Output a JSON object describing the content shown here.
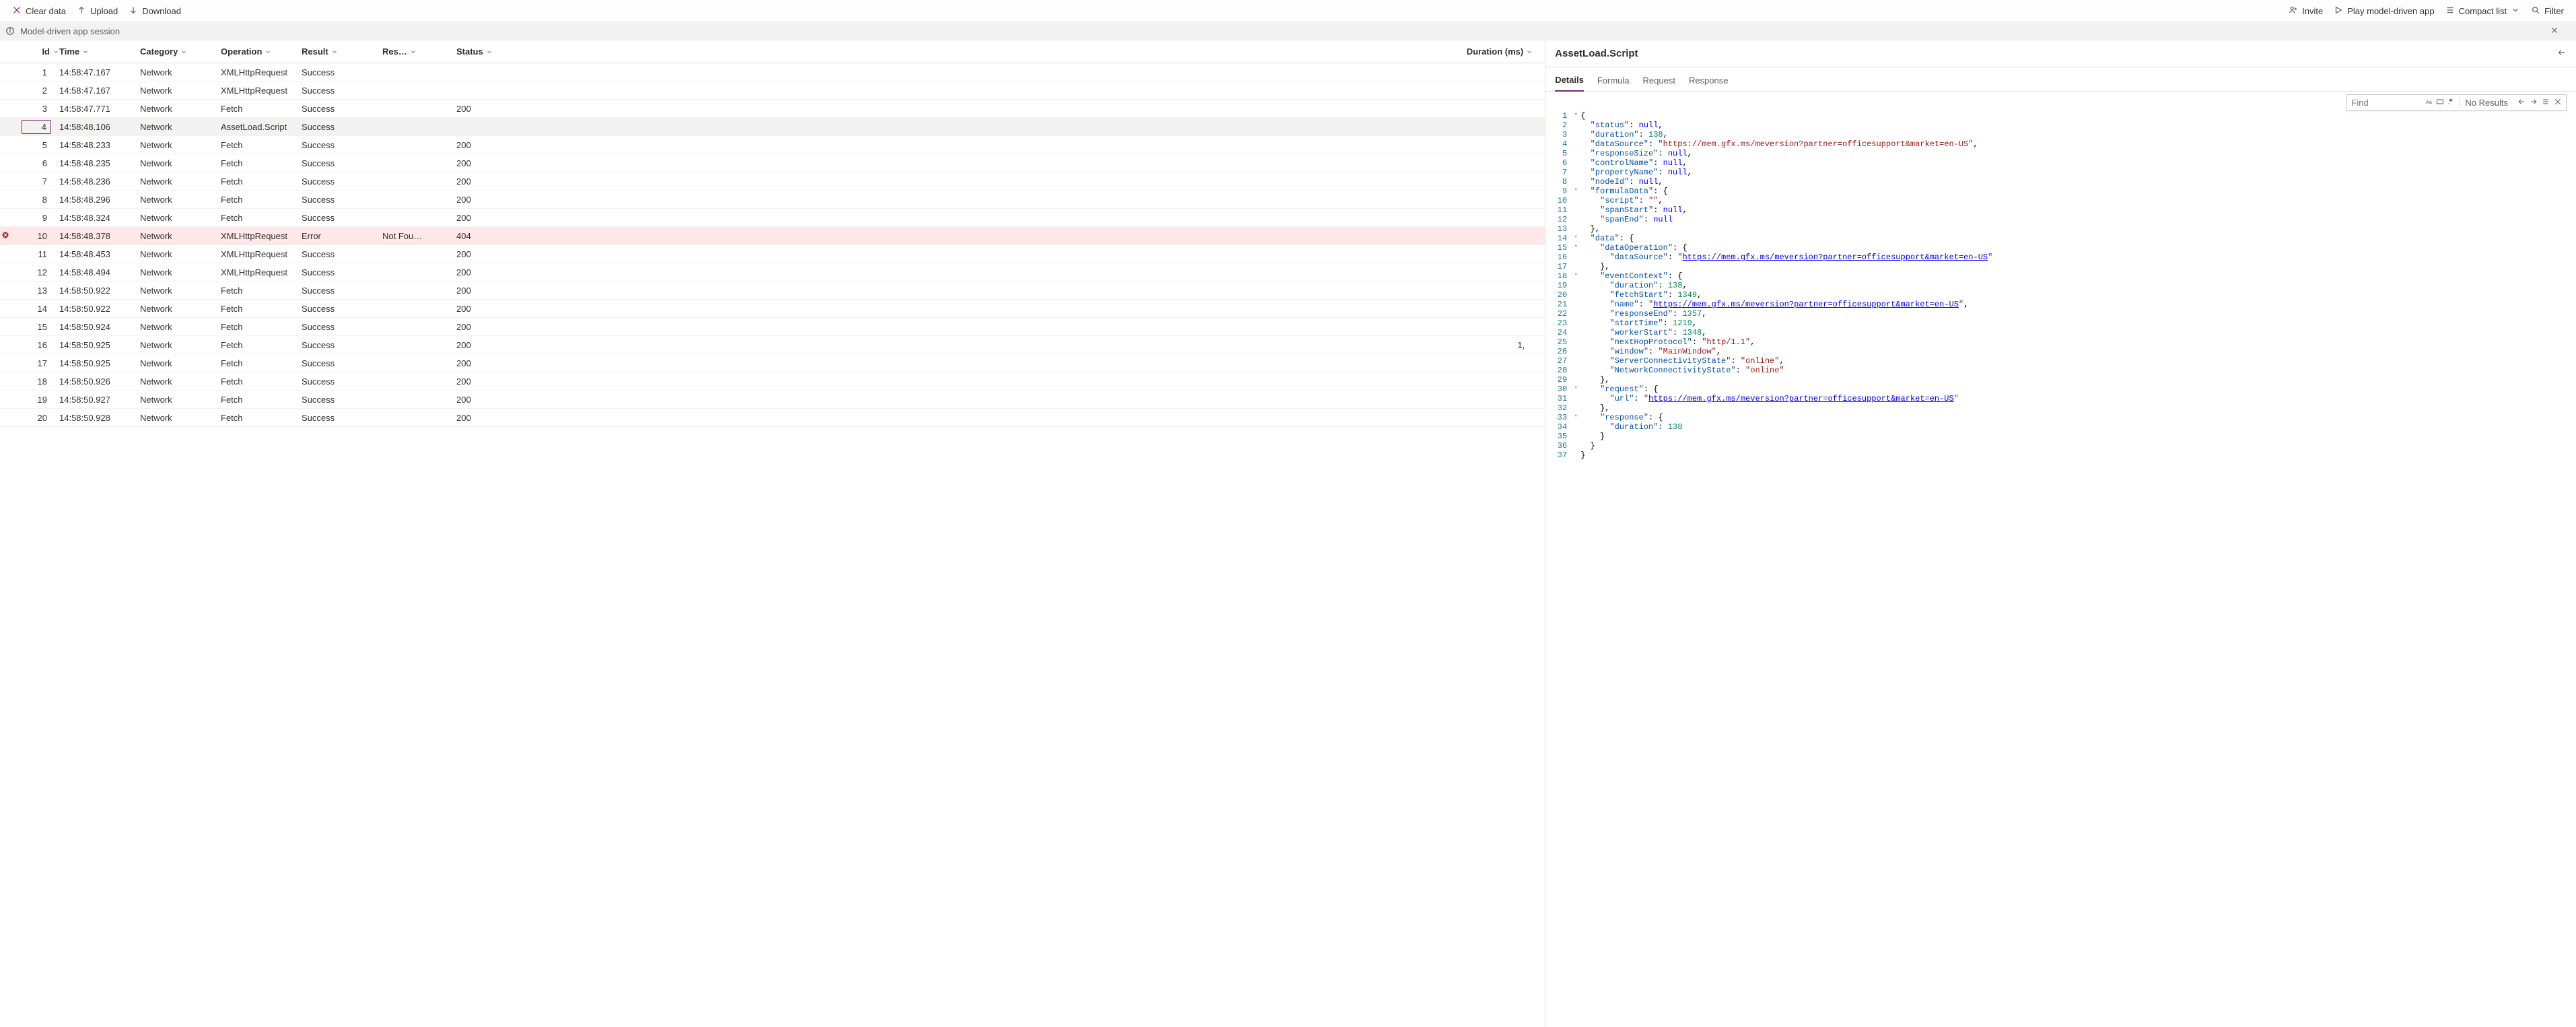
{
  "toolbar": {
    "clear": "Clear data",
    "upload": "Upload",
    "download": "Download",
    "invite": "Invite",
    "play": "Play model-driven app",
    "compact": "Compact list",
    "filter": "Filter"
  },
  "session_label": "Model-driven app session",
  "columns": {
    "id": "Id",
    "time": "Time",
    "category": "Category",
    "operation": "Operation",
    "result": "Result",
    "response": "Res…",
    "status": "Status",
    "duration": "Duration (ms)"
  },
  "rows": [
    {
      "id": "1",
      "time": "14:58:47.167",
      "cat": "Network",
      "op": "XMLHttpRequest",
      "res": "Success",
      "resp": "",
      "status": "",
      "dur": "",
      "err": false,
      "sel": false
    },
    {
      "id": "2",
      "time": "14:58:47.167",
      "cat": "Network",
      "op": "XMLHttpRequest",
      "res": "Success",
      "resp": "",
      "status": "",
      "dur": "",
      "err": false,
      "sel": false
    },
    {
      "id": "3",
      "time": "14:58:47.771",
      "cat": "Network",
      "op": "Fetch",
      "res": "Success",
      "resp": "",
      "status": "200",
      "dur": "",
      "err": false,
      "sel": false
    },
    {
      "id": "4",
      "time": "14:58:48.106",
      "cat": "Network",
      "op": "AssetLoad.Script",
      "res": "Success",
      "resp": "",
      "status": "",
      "dur": "",
      "err": false,
      "sel": true
    },
    {
      "id": "5",
      "time": "14:58:48.233",
      "cat": "Network",
      "op": "Fetch",
      "res": "Success",
      "resp": "",
      "status": "200",
      "dur": "",
      "err": false,
      "sel": false
    },
    {
      "id": "6",
      "time": "14:58:48.235",
      "cat": "Network",
      "op": "Fetch",
      "res": "Success",
      "resp": "",
      "status": "200",
      "dur": "",
      "err": false,
      "sel": false
    },
    {
      "id": "7",
      "time": "14:58:48.236",
      "cat": "Network",
      "op": "Fetch",
      "res": "Success",
      "resp": "",
      "status": "200",
      "dur": "",
      "err": false,
      "sel": false
    },
    {
      "id": "8",
      "time": "14:58:48.296",
      "cat": "Network",
      "op": "Fetch",
      "res": "Success",
      "resp": "",
      "status": "200",
      "dur": "",
      "err": false,
      "sel": false
    },
    {
      "id": "9",
      "time": "14:58:48.324",
      "cat": "Network",
      "op": "Fetch",
      "res": "Success",
      "resp": "",
      "status": "200",
      "dur": "",
      "err": false,
      "sel": false
    },
    {
      "id": "10",
      "time": "14:58:48.378",
      "cat": "Network",
      "op": "XMLHttpRequest",
      "res": "Error",
      "resp": "Not Fou…",
      "status": "404",
      "dur": "",
      "err": true,
      "sel": false
    },
    {
      "id": "11",
      "time": "14:58:48.453",
      "cat": "Network",
      "op": "XMLHttpRequest",
      "res": "Success",
      "resp": "",
      "status": "200",
      "dur": "",
      "err": false,
      "sel": false
    },
    {
      "id": "12",
      "time": "14:58:48.494",
      "cat": "Network",
      "op": "XMLHttpRequest",
      "res": "Success",
      "resp": "",
      "status": "200",
      "dur": "",
      "err": false,
      "sel": false
    },
    {
      "id": "13",
      "time": "14:58:50.922",
      "cat": "Network",
      "op": "Fetch",
      "res": "Success",
      "resp": "",
      "status": "200",
      "dur": "",
      "err": false,
      "sel": false
    },
    {
      "id": "14",
      "time": "14:58:50.922",
      "cat": "Network",
      "op": "Fetch",
      "res": "Success",
      "resp": "",
      "status": "200",
      "dur": "",
      "err": false,
      "sel": false
    },
    {
      "id": "15",
      "time": "14:58:50.924",
      "cat": "Network",
      "op": "Fetch",
      "res": "Success",
      "resp": "",
      "status": "200",
      "dur": "",
      "err": false,
      "sel": false
    },
    {
      "id": "16",
      "time": "14:58:50.925",
      "cat": "Network",
      "op": "Fetch",
      "res": "Success",
      "resp": "",
      "status": "200",
      "dur": "1,",
      "err": false,
      "sel": false
    },
    {
      "id": "17",
      "time": "14:58:50.925",
      "cat": "Network",
      "op": "Fetch",
      "res": "Success",
      "resp": "",
      "status": "200",
      "dur": "",
      "err": false,
      "sel": false
    },
    {
      "id": "18",
      "time": "14:58:50.926",
      "cat": "Network",
      "op": "Fetch",
      "res": "Success",
      "resp": "",
      "status": "200",
      "dur": "",
      "err": false,
      "sel": false
    },
    {
      "id": "19",
      "time": "14:58:50.927",
      "cat": "Network",
      "op": "Fetch",
      "res": "Success",
      "resp": "",
      "status": "200",
      "dur": "",
      "err": false,
      "sel": false
    },
    {
      "id": "20",
      "time": "14:58:50.928",
      "cat": "Network",
      "op": "Fetch",
      "res": "Success",
      "resp": "",
      "status": "200",
      "dur": "",
      "err": false,
      "sel": false
    }
  ],
  "detail": {
    "title": "AssetLoad.Script",
    "tabs": {
      "details": "Details",
      "formula": "Formula",
      "request": "Request",
      "response": "Response"
    },
    "find_placeholder": "Find",
    "find_results": "No Results"
  },
  "code": [
    {
      "n": 1,
      "f": "▾",
      "i": 0,
      "t": [
        [
          "p",
          "{"
        ]
      ]
    },
    {
      "n": 2,
      "f": "",
      "i": 1,
      "t": [
        [
          "k",
          "\"status\""
        ],
        [
          "p",
          ": "
        ],
        [
          "nl",
          "null"
        ],
        [
          "p",
          ","
        ]
      ]
    },
    {
      "n": 3,
      "f": "",
      "i": 1,
      "t": [
        [
          "k",
          "\"duration\""
        ],
        [
          "p",
          ": "
        ],
        [
          "n",
          "138"
        ],
        [
          "p",
          ","
        ]
      ]
    },
    {
      "n": 4,
      "f": "",
      "i": 1,
      "t": [
        [
          "k",
          "\"dataSource\""
        ],
        [
          "p",
          ": "
        ],
        [
          "s",
          "\"https://mem.gfx.ms/meversion?partner=officesupport&market=en-US\""
        ],
        [
          "p",
          ","
        ]
      ]
    },
    {
      "n": 5,
      "f": "",
      "i": 1,
      "t": [
        [
          "k",
          "\"responseSize\""
        ],
        [
          "p",
          ": "
        ],
        [
          "nl",
          "null"
        ],
        [
          "p",
          ","
        ]
      ]
    },
    {
      "n": 6,
      "f": "",
      "i": 1,
      "t": [
        [
          "k",
          "\"controlName\""
        ],
        [
          "p",
          ": "
        ],
        [
          "nl",
          "null"
        ],
        [
          "p",
          ","
        ]
      ]
    },
    {
      "n": 7,
      "f": "",
      "i": 1,
      "t": [
        [
          "k",
          "\"propertyName\""
        ],
        [
          "p",
          ": "
        ],
        [
          "nl",
          "null"
        ],
        [
          "p",
          ","
        ]
      ]
    },
    {
      "n": 8,
      "f": "",
      "i": 1,
      "t": [
        [
          "k",
          "\"nodeId\""
        ],
        [
          "p",
          ": "
        ],
        [
          "nl",
          "null"
        ],
        [
          "p",
          ","
        ]
      ]
    },
    {
      "n": 9,
      "f": "▾",
      "i": 1,
      "t": [
        [
          "k",
          "\"formulaData\""
        ],
        [
          "p",
          ": {"
        ]
      ]
    },
    {
      "n": 10,
      "f": "",
      "i": 2,
      "t": [
        [
          "k",
          "\"script\""
        ],
        [
          "p",
          ": "
        ],
        [
          "s",
          "\"\""
        ],
        [
          "p",
          ","
        ]
      ]
    },
    {
      "n": 11,
      "f": "",
      "i": 2,
      "t": [
        [
          "k",
          "\"spanStart\""
        ],
        [
          "p",
          ": "
        ],
        [
          "nl",
          "null"
        ],
        [
          "p",
          ","
        ]
      ]
    },
    {
      "n": 12,
      "f": "",
      "i": 2,
      "t": [
        [
          "k",
          "\"spanEnd\""
        ],
        [
          "p",
          ": "
        ],
        [
          "nl",
          "null"
        ]
      ]
    },
    {
      "n": 13,
      "f": "",
      "i": 1,
      "t": [
        [
          "p",
          "},"
        ]
      ]
    },
    {
      "n": 14,
      "f": "▾",
      "i": 1,
      "t": [
        [
          "k",
          "\"data\""
        ],
        [
          "p",
          ": {"
        ]
      ]
    },
    {
      "n": 15,
      "f": "▾",
      "i": 2,
      "t": [
        [
          "k",
          "\"dataOperation\""
        ],
        [
          "p",
          ": {"
        ]
      ]
    },
    {
      "n": 16,
      "f": "",
      "i": 3,
      "t": [
        [
          "k",
          "\"dataSource\""
        ],
        [
          "p",
          ": "
        ],
        [
          "s",
          "\""
        ],
        [
          "u",
          "https://mem.gfx.ms/meversion?partner=officesupport&market=en-US"
        ],
        [
          "s",
          "\""
        ]
      ]
    },
    {
      "n": 17,
      "f": "",
      "i": 2,
      "t": [
        [
          "p",
          "},"
        ]
      ]
    },
    {
      "n": 18,
      "f": "▾",
      "i": 2,
      "t": [
        [
          "k",
          "\"eventContext\""
        ],
        [
          "p",
          ": {"
        ]
      ]
    },
    {
      "n": 19,
      "f": "",
      "i": 3,
      "t": [
        [
          "k",
          "\"duration\""
        ],
        [
          "p",
          ": "
        ],
        [
          "n",
          "138"
        ],
        [
          "p",
          ","
        ]
      ]
    },
    {
      "n": 20,
      "f": "",
      "i": 3,
      "t": [
        [
          "k",
          "\"fetchStart\""
        ],
        [
          "p",
          ": "
        ],
        [
          "n",
          "1349"
        ],
        [
          "p",
          ","
        ]
      ]
    },
    {
      "n": 21,
      "f": "",
      "i": 3,
      "t": [
        [
          "k",
          "\"name\""
        ],
        [
          "p",
          ": "
        ],
        [
          "s",
          "\""
        ],
        [
          "u",
          "https://mem.gfx.ms/meversion?partner=officesupport&market=en-US"
        ],
        [
          "s",
          "\""
        ],
        [
          "p",
          ","
        ]
      ]
    },
    {
      "n": 22,
      "f": "",
      "i": 3,
      "t": [
        [
          "k",
          "\"responseEnd\""
        ],
        [
          "p",
          ": "
        ],
        [
          "n",
          "1357"
        ],
        [
          "p",
          ","
        ]
      ]
    },
    {
      "n": 23,
      "f": "",
      "i": 3,
      "t": [
        [
          "k",
          "\"startTime\""
        ],
        [
          "p",
          ": "
        ],
        [
          "n",
          "1219"
        ],
        [
          "p",
          ","
        ]
      ]
    },
    {
      "n": 24,
      "f": "",
      "i": 3,
      "t": [
        [
          "k",
          "\"workerStart\""
        ],
        [
          "p",
          ": "
        ],
        [
          "n",
          "1348"
        ],
        [
          "p",
          ","
        ]
      ]
    },
    {
      "n": 25,
      "f": "",
      "i": 3,
      "t": [
        [
          "k",
          "\"nextHopProtocol\""
        ],
        [
          "p",
          ": "
        ],
        [
          "s",
          "\"http/1.1\""
        ],
        [
          "p",
          ","
        ]
      ]
    },
    {
      "n": 26,
      "f": "",
      "i": 3,
      "t": [
        [
          "k",
          "\"window\""
        ],
        [
          "p",
          ": "
        ],
        [
          "s",
          "\"MainWindow\""
        ],
        [
          "p",
          ","
        ]
      ]
    },
    {
      "n": 27,
      "f": "",
      "i": 3,
      "t": [
        [
          "k",
          "\"ServerConnectivityState\""
        ],
        [
          "p",
          ": "
        ],
        [
          "s",
          "\"online\""
        ],
        [
          "p",
          ","
        ]
      ]
    },
    {
      "n": 28,
      "f": "",
      "i": 3,
      "t": [
        [
          "k",
          "\"NetworkConnectivityState\""
        ],
        [
          "p",
          ": "
        ],
        [
          "s",
          "\"online\""
        ]
      ]
    },
    {
      "n": 29,
      "f": "",
      "i": 2,
      "t": [
        [
          "p",
          "},"
        ]
      ]
    },
    {
      "n": 30,
      "f": "▾",
      "i": 2,
      "t": [
        [
          "k",
          "\"request\""
        ],
        [
          "p",
          ": {"
        ]
      ]
    },
    {
      "n": 31,
      "f": "",
      "i": 3,
      "t": [
        [
          "k",
          "\"url\""
        ],
        [
          "p",
          ": "
        ],
        [
          "s",
          "\""
        ],
        [
          "u",
          "https://mem.gfx.ms/meversion?partner=officesupport&market=en-US"
        ],
        [
          "s",
          "\""
        ]
      ]
    },
    {
      "n": 32,
      "f": "",
      "i": 2,
      "t": [
        [
          "p",
          "},"
        ]
      ]
    },
    {
      "n": 33,
      "f": "▾",
      "i": 2,
      "t": [
        [
          "k",
          "\"response\""
        ],
        [
          "p",
          ": {"
        ]
      ]
    },
    {
      "n": 34,
      "f": "",
      "i": 3,
      "t": [
        [
          "k",
          "\"duration\""
        ],
        [
          "p",
          ": "
        ],
        [
          "n",
          "138"
        ]
      ]
    },
    {
      "n": 35,
      "f": "",
      "i": 2,
      "t": [
        [
          "p",
          "}"
        ]
      ]
    },
    {
      "n": 36,
      "f": "",
      "i": 1,
      "t": [
        [
          "p",
          "}"
        ]
      ]
    },
    {
      "n": 37,
      "f": "",
      "i": 0,
      "t": [
        [
          "p",
          "}"
        ]
      ]
    }
  ]
}
